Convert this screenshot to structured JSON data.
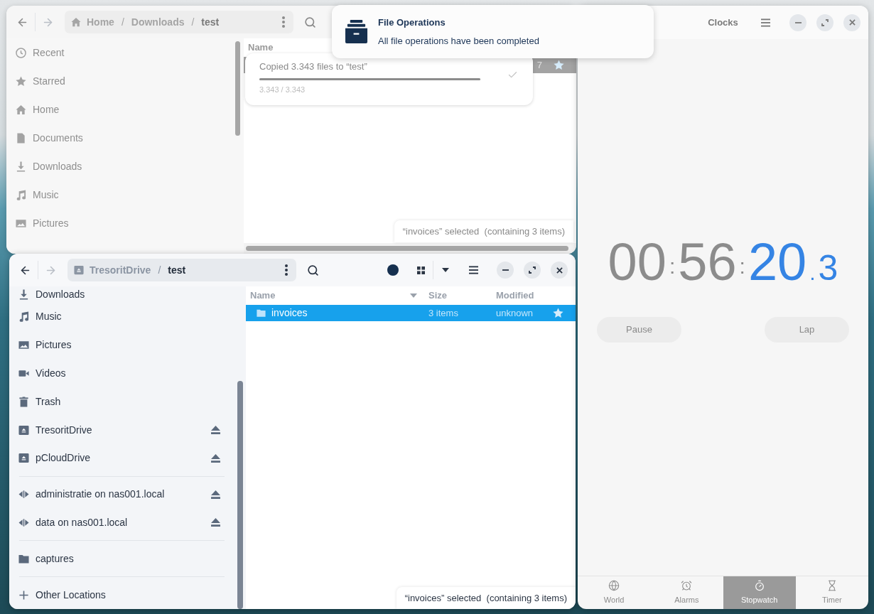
{
  "notification": {
    "title": "File Operations",
    "body": "All file operations have been completed"
  },
  "files_back": {
    "active": false,
    "path": {
      "separator": "/",
      "crumbs": [
        {
          "label": "Home",
          "kind": "home",
          "current": false
        },
        {
          "label": "Downloads",
          "current": false
        },
        {
          "label": "test",
          "current": true
        }
      ]
    },
    "sidebar": {
      "sections": [
        {
          "items": [
            {
              "label": "Recent",
              "kind": "recent"
            },
            {
              "label": "Starred",
              "kind": "starred"
            },
            {
              "label": "Home",
              "kind": "home"
            },
            {
              "label": "Documents",
              "kind": "documents"
            },
            {
              "label": "Downloads",
              "kind": "downloads"
            },
            {
              "label": "Music",
              "kind": "music"
            },
            {
              "label": "Pictures",
              "kind": "pictures"
            }
          ]
        }
      ]
    },
    "columns": [
      {
        "label": "Name"
      }
    ],
    "rows": [
      {
        "column_3": "7",
        "selected": true
      }
    ],
    "operation": {
      "title": "Copied 3.343 files to “test”",
      "level": 1,
      "progress": "3.343 / 3.343",
      "done": true
    },
    "status": "“invoices” selected  (containing 3 items)"
  },
  "files_front": {
    "active": true,
    "path": {
      "separator": "/",
      "crumbs": [
        {
          "label": "TresoritDrive",
          "kind": "drive",
          "current": false
        },
        {
          "label": "test",
          "current": true
        }
      ]
    },
    "sidebar": {
      "sections": [
        {
          "items": [
            {
              "label": "Downloads",
              "kind": "downloads",
              "eject": false
            },
            {
              "label": "Music",
              "kind": "music",
              "eject": false
            },
            {
              "label": "Pictures",
              "kind": "pictures",
              "eject": false
            },
            {
              "label": "Videos",
              "kind": "videos",
              "eject": false
            },
            {
              "label": "Trash",
              "kind": "trash",
              "eject": false
            },
            {
              "label": "TresoritDrive",
              "kind": "drive",
              "eject": true
            },
            {
              "label": "pCloudDrive",
              "kind": "drive",
              "eject": true
            }
          ]
        },
        {
          "items": [
            {
              "label": "administratie on nas001.local",
              "kind": "network",
              "eject": true
            },
            {
              "label": "data on nas001.local",
              "kind": "network",
              "eject": true
            }
          ]
        },
        {
          "items": [
            {
              "label": "captures",
              "kind": "folder",
              "eject": false
            }
          ]
        },
        {
          "items": [
            {
              "label": "Other Locations",
              "kind": "add",
              "eject": false
            }
          ]
        }
      ]
    },
    "columns": [
      {
        "label": "Name",
        "sorted": true
      },
      {
        "label": "Size",
        "sorted": false
      },
      {
        "label": "Modified",
        "sorted": false
      }
    ],
    "rows": [
      {
        "name": "invoices",
        "size": "3 items",
        "modified": "unknown",
        "selected": true
      }
    ],
    "status": "“invoices” selected  (containing 3 items)"
  },
  "clocks": {
    "title": "Clocks",
    "time": [
      {
        "text": "00",
        "kind": "digits",
        "active": false
      },
      {
        "text": ":",
        "kind": "separator",
        "active": false
      },
      {
        "text": "56",
        "kind": "digits",
        "active": false
      },
      {
        "text": ":",
        "kind": "separator",
        "active": false
      },
      {
        "text": "20",
        "kind": "digits",
        "active": true
      },
      {
        "text": ".",
        "kind": "point",
        "active": true
      },
      {
        "text": "3",
        "kind": "fraction",
        "active": true
      }
    ],
    "buttons": [
      {
        "label": "Pause"
      },
      {
        "label": "Lap"
      }
    ],
    "tabs": [
      {
        "label": "World",
        "kind": "world",
        "selected": false
      },
      {
        "label": "Alarms",
        "kind": "alarm",
        "selected": false
      },
      {
        "label": "Stopwatch",
        "kind": "stopwatch",
        "selected": true
      },
      {
        "label": "Timer",
        "kind": "timer",
        "selected": false
      }
    ]
  }
}
